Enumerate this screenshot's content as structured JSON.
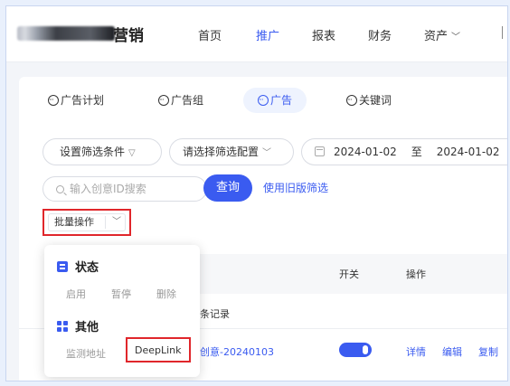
{
  "nav": {
    "brand_suffix": "营销",
    "items": [
      {
        "label": "首页",
        "active": false
      },
      {
        "label": "推广",
        "active": true
      },
      {
        "label": "报表",
        "active": false
      },
      {
        "label": "财务",
        "active": false
      },
      {
        "label": "资产",
        "active": false,
        "has_dropdown": true
      }
    ]
  },
  "tabs": [
    {
      "label": "广告计划",
      "active": false
    },
    {
      "label": "广告组",
      "active": false
    },
    {
      "label": "广告",
      "active": true
    },
    {
      "label": "关键词",
      "active": false
    }
  ],
  "filters": {
    "set_conditions": "设置筛选条件",
    "select_config": "请选择筛选配置",
    "date_start": "2024-01-02",
    "date_to": "至",
    "date_end": "2024-01-02",
    "search_placeholder": "输入创意ID搜索",
    "query_button": "查询",
    "old_filter_link": "使用旧版筛选"
  },
  "batch": {
    "label": "批量操作"
  },
  "table": {
    "headers": [
      "开关",
      "操作"
    ],
    "records_suffix": "条记录",
    "row": {
      "creative_name": "创意-20240103",
      "switch_on": true,
      "actions": [
        "详情",
        "编辑",
        "复制"
      ]
    }
  },
  "dropdown": {
    "groups": [
      {
        "title": "状态",
        "items": [
          "启用",
          "暂停",
          "删除"
        ]
      },
      {
        "title": "其他",
        "items": [
          "监测地址",
          "DeepLink"
        ]
      }
    ]
  },
  "colors": {
    "accent": "#3a5bf0",
    "highlight_border": "#e0262b"
  }
}
